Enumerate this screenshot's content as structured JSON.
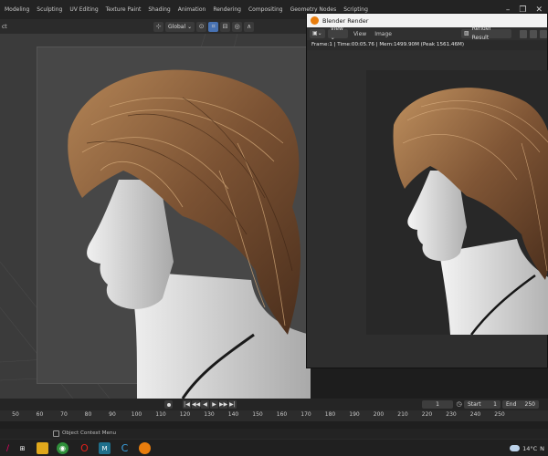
{
  "workspaces": [
    "Modeling",
    "Sculpting",
    "UV Editing",
    "Texture Paint",
    "Shading",
    "Animation",
    "Rendering",
    "Compositing",
    "Geometry Nodes",
    "Scripting"
  ],
  "window_controls": {
    "minimize": "–",
    "restore": "❐",
    "close": "✕"
  },
  "viewport": {
    "mode_label": "ct",
    "orientation_label": "Global",
    "orientation_arrow": "⌄"
  },
  "render_window": {
    "title": "Blender Render",
    "menus": [
      "View",
      "Image"
    ],
    "view_dropdown": "View ⌄",
    "result_label": "Render Result",
    "stats": "Frame:1 | Time:00:05.76 | Mem:1499.90M (Peak 1561.46M)"
  },
  "timeline": {
    "current_frame": "1",
    "start_label": "Start",
    "start_value": "1",
    "end_label": "End",
    "end_value": "250",
    "transport": [
      "|◀",
      "◀◀",
      "◀",
      "▶",
      "▶▶",
      "▶|"
    ],
    "ruler_ticks": [
      "50",
      "60",
      "70",
      "80",
      "90",
      "100",
      "110",
      "120",
      "130",
      "140",
      "150",
      "160",
      "170",
      "180",
      "190",
      "200",
      "210",
      "220",
      "230",
      "240",
      "250"
    ]
  },
  "status": {
    "context_menu_hint": "Object Context Menu"
  },
  "taskbar": {
    "weather": "14°C",
    "weather_suffix": "N"
  }
}
